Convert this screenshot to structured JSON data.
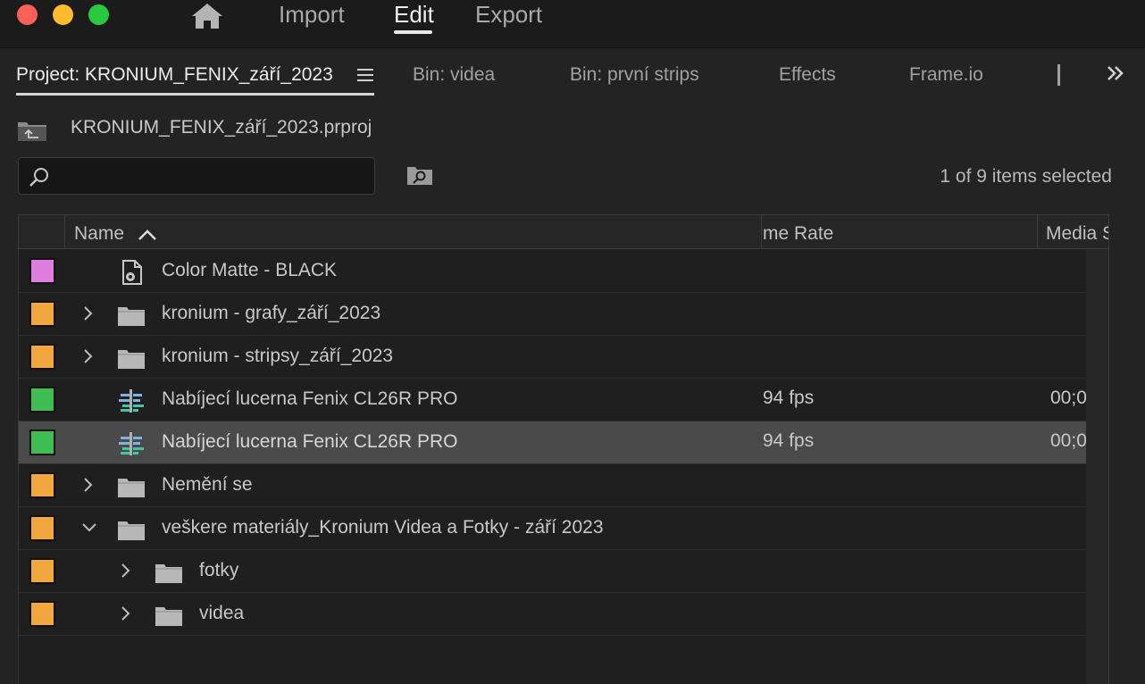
{
  "window": {
    "modes": {
      "import": "Import",
      "edit": "Edit",
      "export": "Export",
      "active": "Edit"
    }
  },
  "tabs": [
    {
      "label": "Project: KRONIUM_FENIX_září_2023",
      "active": true
    },
    {
      "label": "Bin: videa"
    },
    {
      "label": "Bin: první strips"
    },
    {
      "label": "Effects"
    },
    {
      "label": "Frame.io"
    }
  ],
  "project": {
    "file_name": "KRONIUM_FENIX_září_2023.prproj",
    "search": {
      "value": "",
      "placeholder": ""
    },
    "selection_status": "1 of 9 items selected"
  },
  "columns": {
    "name": "Name",
    "frame_rate": "me Rate",
    "media": "Media S"
  },
  "rows": [
    {
      "label_color": "#e07ee0",
      "type": "color-matte",
      "name": "Color Matte - BLACK",
      "fps": "",
      "media": "",
      "expand": "none",
      "indent": 0
    },
    {
      "label_color": "#f0a83c",
      "type": "bin",
      "name": "kronium - grafy_září_2023",
      "fps": "",
      "media": "",
      "expand": "collapsed",
      "indent": 0
    },
    {
      "label_color": "#f0a83c",
      "type": "bin",
      "name": "kronium - stripsy_září_2023",
      "fps": "",
      "media": "",
      "expand": "collapsed",
      "indent": 0
    },
    {
      "label_color": "#3dbd52",
      "type": "sequence",
      "name": "Nabíjecí lucerna Fenix CL26R PRO",
      "fps": "94 fps",
      "media": "00;0",
      "expand": "none",
      "indent": 0
    },
    {
      "label_color": "#3dbd52",
      "type": "sequence",
      "name": "Nabíjecí lucerna Fenix CL26R PRO",
      "fps": "94 fps",
      "media": "00;0",
      "expand": "none",
      "indent": 0,
      "selected": true
    },
    {
      "label_color": "#f0a83c",
      "type": "bin",
      "name": "Nemění se",
      "fps": "",
      "media": "",
      "expand": "collapsed",
      "indent": 0
    },
    {
      "label_color": "#f0a83c",
      "type": "bin",
      "name": "veškere materiály_Kronium Videa a Fotky - září 2023",
      "fps": "",
      "media": "",
      "expand": "expanded",
      "indent": 0
    },
    {
      "label_color": "#f0a83c",
      "type": "bin",
      "name": "fotky",
      "fps": "",
      "media": "",
      "expand": "collapsed",
      "indent": 1
    },
    {
      "label_color": "#f0a83c",
      "type": "bin",
      "name": "videa",
      "fps": "",
      "media": "",
      "expand": "collapsed",
      "indent": 1
    }
  ],
  "icons": {
    "home": "home-icon",
    "up_folder": "up-folder-icon",
    "search": "search-icon",
    "bin_search": "new-search-bin-icon",
    "panel_menu": "hamburger-menu-icon",
    "overflow": "double-chevron-right-icon"
  }
}
